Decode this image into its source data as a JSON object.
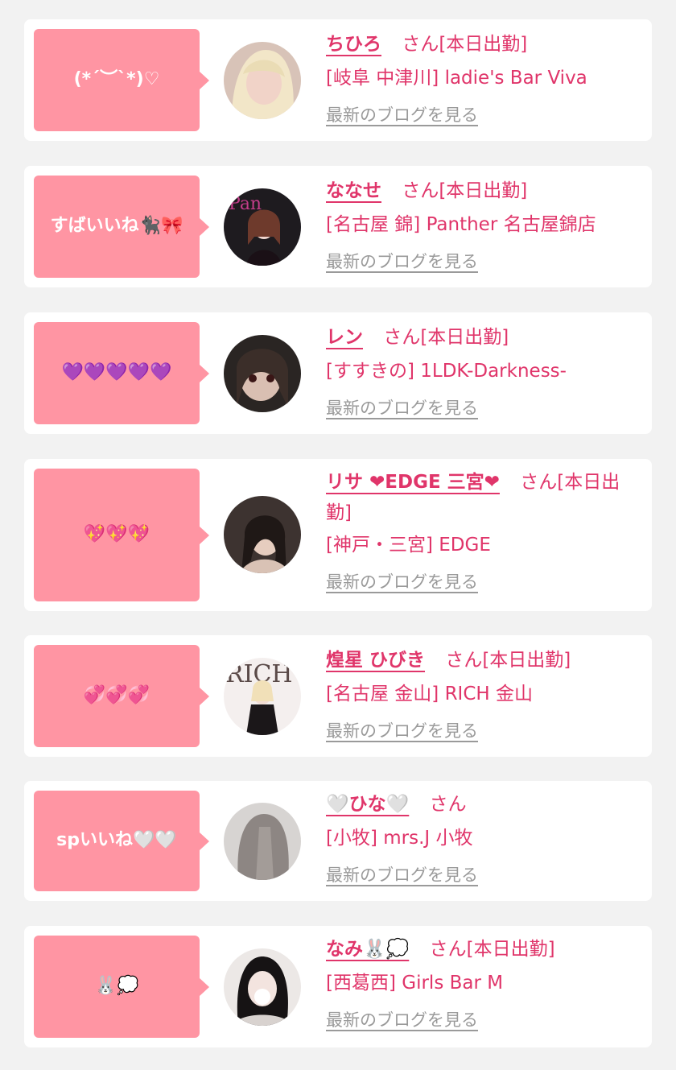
{
  "blog_link_label": "最新のブログを見る",
  "honorific": "さん",
  "colors": {
    "background": "#f2f2f2",
    "card": "#ffffff",
    "bubble": "#ff95a3",
    "accent_text": "#e0356a",
    "blog_link": "#9a9a9a"
  },
  "entries": [
    {
      "comment": "(*´︶`*)♡",
      "name": "ちひろ",
      "status": "[本日出勤]",
      "shop": "[岐阜 中津川] ladie's Bar Viva",
      "avatar_icon": "profile-photo-icon"
    },
    {
      "comment": "すばいいね🐈‍⬛🎀",
      "name": "ななせ",
      "status": "[本日出勤]",
      "shop": "[名古屋 錦] Panther 名古屋錦店",
      "avatar_icon": "profile-photo-icon"
    },
    {
      "comment": "💜💜💜💜💜",
      "name": "レン",
      "status": "[本日出勤]",
      "shop": "[すすきの] 1LDK-Darkness-",
      "avatar_icon": "profile-photo-icon"
    },
    {
      "comment": "💖💖💖",
      "name": "リサ ❤︎EDGE 三宮❤︎",
      "status": "[本日出勤]",
      "shop": "[神戸・三宮] EDGE",
      "avatar_icon": "profile-photo-icon"
    },
    {
      "comment": "💞💞💞",
      "name": "煌星 ひびき",
      "status": "[本日出勤]",
      "shop": "[名古屋 金山] RICH 金山",
      "avatar_icon": "profile-photo-icon"
    },
    {
      "comment": "spいいね🤍🤍",
      "name": "🤍ひな🤍",
      "status": "",
      "shop": "[小牧] mrs.J 小牧",
      "avatar_icon": "profile-photo-icon"
    },
    {
      "comment": "🐰💭",
      "name": "なみ🐰💭",
      "status": "[本日出勤]",
      "shop": "[西葛西] Girls Bar M",
      "avatar_icon": "profile-photo-icon"
    }
  ]
}
